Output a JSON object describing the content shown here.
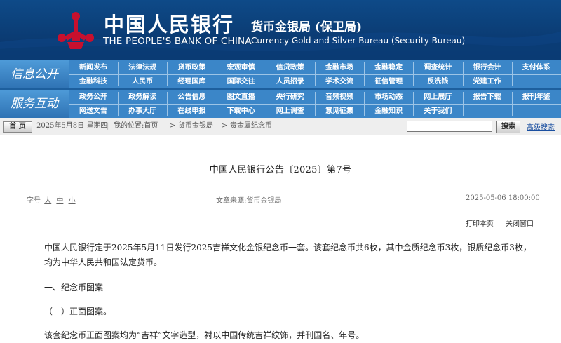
{
  "header": {
    "cn_name": "中国人民银行",
    "en_name": "THE PEOPLE'S BANK OF CHINA",
    "bureau_cn": "货币金银局 (保卫局)",
    "bureau_en": "Currency Gold and Silver Bureau (Security Bureau)",
    "logo_icon": "pboc-emblem-icon",
    "brand_color": "#c8102e"
  },
  "nav": {
    "group1_label": "信息公开",
    "group2_label": "服务互动",
    "group1_row1": [
      "新闻发布",
      "法律法规",
      "货币政策",
      "宏观审慎",
      "信贷政策",
      "金融市场",
      "金融稳定",
      "调查统计",
      "银行会计",
      "支付体系"
    ],
    "group1_row2": [
      "金融科技",
      "人民币",
      "经理国库",
      "国际交往",
      "人员招录",
      "学术交流",
      "征信管理",
      "反洗钱",
      "党建工作"
    ],
    "group2_row1": [
      "政务公开",
      "政务解读",
      "公告信息",
      "图文直播",
      "央行研究",
      "音频视频",
      "市场动态",
      "网上展厅",
      "报告下载",
      "报刊年鉴"
    ],
    "group2_row2": [
      "网送文告",
      "办事大厅",
      "在线申报",
      "下载中心",
      "网上调查",
      "意见征集",
      "金融知识",
      "关于我们"
    ]
  },
  "crumb": {
    "home": "首 页",
    "date": "2025年5月8日 星期四",
    "location": "我的位置:首页",
    "arrow": ">",
    "level1": "货币金银局",
    "level2": "贵金属纪念币",
    "search_value": "",
    "search_button": "搜索",
    "advanced": "高级搜索"
  },
  "article": {
    "title": "中国人民银行公告〔2025〕第7号",
    "font_label": "字号",
    "font_large": "大",
    "font_medium": "中",
    "font_small": "小",
    "source": "文章来源:货币金银局",
    "datetime": "2025-05-06 18:00:00",
    "print": "打印本页",
    "close": "关闭窗口",
    "p1": "中国人民银行定于2025年5月11日发行2025吉祥文化金银纪念币一套。该套纪念币共6枚，其中金质纪念币3枚，银质纪念币3枚，均为中华人民共和国法定货币。",
    "h1": "一、纪念币图案",
    "h2": "（一）正面图案。",
    "p2": "该套纪念币正面图案均为“吉祥”文字造型，衬以中国传统吉祥纹饰，并刊国名、年号。"
  }
}
